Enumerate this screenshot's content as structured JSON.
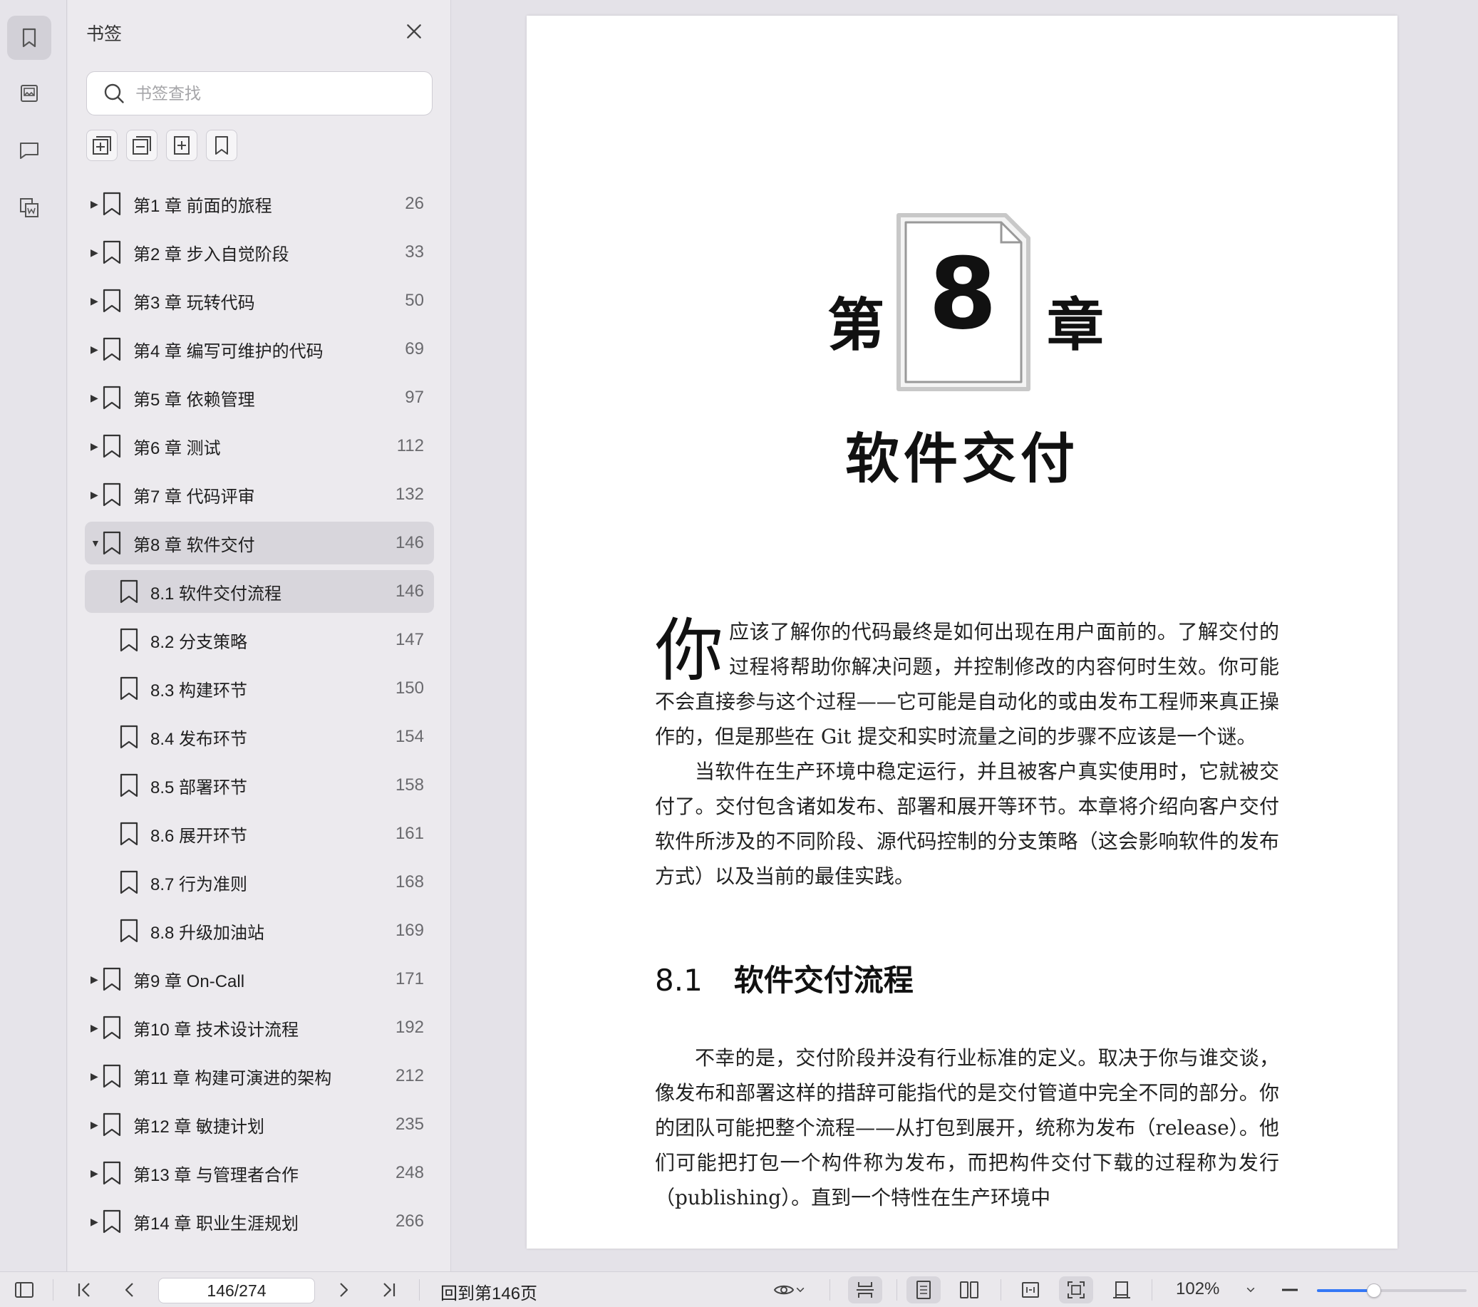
{
  "panel": {
    "title": "书签",
    "search_placeholder": "书签查找"
  },
  "bookmarks": [
    {
      "label": "第1 章 前面的旅程",
      "page": "26",
      "level": 1,
      "state": "collapsed"
    },
    {
      "label": "第2 章 步入自觉阶段",
      "page": "33",
      "level": 1,
      "state": "collapsed"
    },
    {
      "label": "第3 章 玩转代码",
      "page": "50",
      "level": 1,
      "state": "collapsed"
    },
    {
      "label": "第4 章 编写可维护的代码",
      "page": "69",
      "level": 1,
      "state": "collapsed"
    },
    {
      "label": "第5 章 依赖管理",
      "page": "97",
      "level": 1,
      "state": "collapsed"
    },
    {
      "label": "第6 章 测试",
      "page": "112",
      "level": 1,
      "state": "collapsed"
    },
    {
      "label": "第7 章 代码评审",
      "page": "132",
      "level": 1,
      "state": "collapsed"
    },
    {
      "label": "第8 章 软件交付",
      "page": "146",
      "level": 1,
      "state": "expanded"
    },
    {
      "label": "8.1 软件交付流程",
      "page": "146",
      "level": 2,
      "state": "selected"
    },
    {
      "label": "8.2 分支策略",
      "page": "147",
      "level": 2,
      "state": "none"
    },
    {
      "label": "8.3 构建环节",
      "page": "150",
      "level": 2,
      "state": "none"
    },
    {
      "label": "8.4 发布环节",
      "page": "154",
      "level": 2,
      "state": "none"
    },
    {
      "label": "8.5 部署环节",
      "page": "158",
      "level": 2,
      "state": "none"
    },
    {
      "label": "8.6 展开环节",
      "page": "161",
      "level": 2,
      "state": "none"
    },
    {
      "label": "8.7 行为准则",
      "page": "168",
      "level": 2,
      "state": "none"
    },
    {
      "label": "8.8 升级加油站",
      "page": "169",
      "level": 2,
      "state": "none"
    },
    {
      "label": "第9 章 On-Call",
      "page": "171",
      "level": 1,
      "state": "collapsed"
    },
    {
      "label": "第10 章 技术设计流程",
      "page": "192",
      "level": 1,
      "state": "collapsed"
    },
    {
      "label": "第11 章 构建可演进的架构",
      "page": "212",
      "level": 1,
      "state": "collapsed"
    },
    {
      "label": "第12 章 敏捷计划",
      "page": "235",
      "level": 1,
      "state": "collapsed"
    },
    {
      "label": "第13 章 与管理者合作",
      "page": "248",
      "level": 1,
      "state": "collapsed"
    },
    {
      "label": "第14 章 职业生涯规划",
      "page": "266",
      "level": 1,
      "state": "collapsed"
    }
  ],
  "document": {
    "chapter_prefix": "第",
    "chapter_number": "8",
    "chapter_suffix": "章",
    "chapter_title": "软件交付",
    "p1_dropcap": "你",
    "p1_text": "应该了解你的代码最终是如何出现在用户面前的。了解交付的过程将帮助你解决问题，并控制修改的内容何时生效。你可能不会直接参与这个过程——它可能是自动化的或由发布工程师来真正操作的，但是那些在 Git 提交和实时流量之间的步骤不应该是一个谜。",
    "p2_text": "当软件在生产环境中稳定运行，并且被客户真实使用时，它就被交付了。交付包含诸如发布、部署和展开等环节。本章将介绍向客户交付软件所涉及的不同阶段、源代码控制的分支策略（这会影响软件的发布方式）以及当前的最佳实践。",
    "section_number": "8.1",
    "section_title": "软件交付流程",
    "p3_text": "不幸的是，交付阶段并没有行业标准的定义。取决于你与谁交谈，像发布和部署这样的措辞可能指代的是交付管道中完全不同的部分。你的团队可能把整个流程——从打包到展开，统称为发布（release）。他们可能把打包一个构件称为发布，而把构件交付下载的过程称为发行（publishing）。直到一个特性在生产环境中"
  },
  "statusbar": {
    "page_value": "146/274",
    "goto_label": "回到第146页",
    "zoom_label": "102%",
    "zoom_fraction": 0.38
  },
  "colors": {
    "accent": "#3478f6",
    "selected_row": "#d8d6dc",
    "panel_bg": "#eceaee"
  }
}
